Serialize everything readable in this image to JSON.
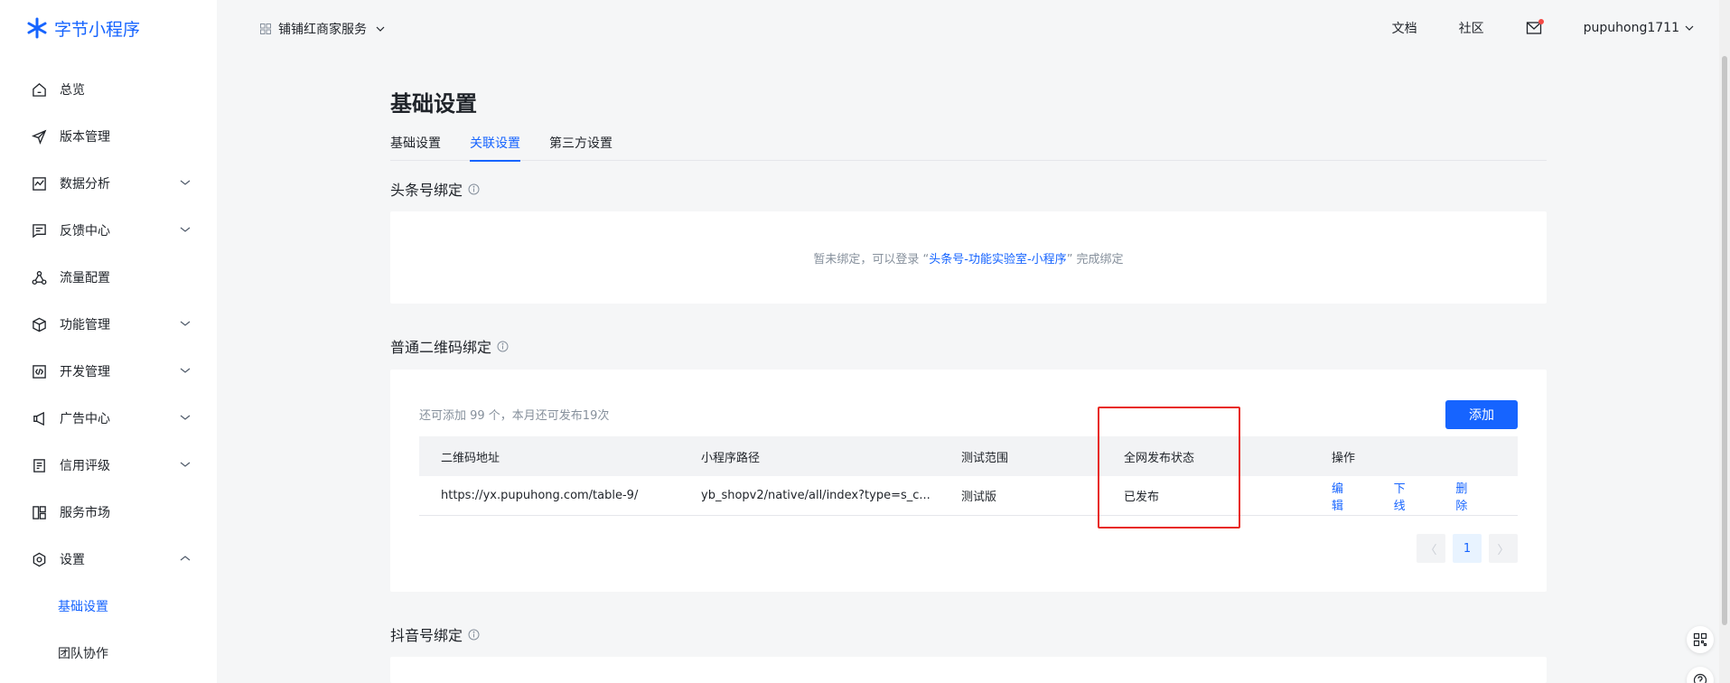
{
  "app": {
    "name": "字节小程序"
  },
  "sidebar": {
    "items": [
      {
        "label": "总览",
        "icon": "home-icon"
      },
      {
        "label": "版本管理",
        "icon": "send-icon"
      },
      {
        "label": "数据分析",
        "icon": "chart-icon"
      },
      {
        "label": "反馈中心",
        "icon": "message-icon"
      },
      {
        "label": "流量配置",
        "icon": "share-icon"
      },
      {
        "label": "功能管理",
        "icon": "cube-icon"
      },
      {
        "label": "开发管理",
        "icon": "code-icon"
      },
      {
        "label": "广告中心",
        "icon": "megaphone-icon"
      },
      {
        "label": "信用评级",
        "icon": "document-icon"
      },
      {
        "label": "服务市场",
        "icon": "layout-icon"
      },
      {
        "label": "设置",
        "icon": "settings-icon"
      }
    ],
    "sub_items": [
      "基础设置",
      "团队协作"
    ]
  },
  "header": {
    "merchant": "铺铺红商家服务",
    "docs": "文档",
    "community": "社区",
    "username": "pupuhong1711"
  },
  "main": {
    "title": "基础设置",
    "tabs": [
      "基础设置",
      "关联设置",
      "第三方设置"
    ],
    "toutiao": {
      "title": "头条号绑定",
      "msg_before": "暂未绑定，可以登录 “",
      "msg_link": "头条号-功能实验室-小程序",
      "msg_after": "” 完成绑定"
    },
    "qrcode": {
      "title": "普通二维码绑定",
      "quota": "还可添加 99 个，本月还可发布19次",
      "add_label": "添加",
      "columns": [
        "二维码地址",
        "小程序路径",
        "测试范围",
        "全网发布状态",
        "操作"
      ],
      "rows": [
        {
          "url": "https://yx.pupuhong.com/table-9/",
          "path": "yb_shopv2/native/all/index?type=s_c...",
          "scope": "测试版",
          "status": "已发布",
          "ops": [
            "编辑",
            "下线",
            "删除"
          ]
        }
      ],
      "page": "1",
      "prev": "〈",
      "next": "〉"
    },
    "douyin": {
      "title": "抖音号绑定"
    }
  },
  "colors": {
    "accent": "#1664ff",
    "highlight": "#e8271c",
    "notification": "#f54a45"
  }
}
